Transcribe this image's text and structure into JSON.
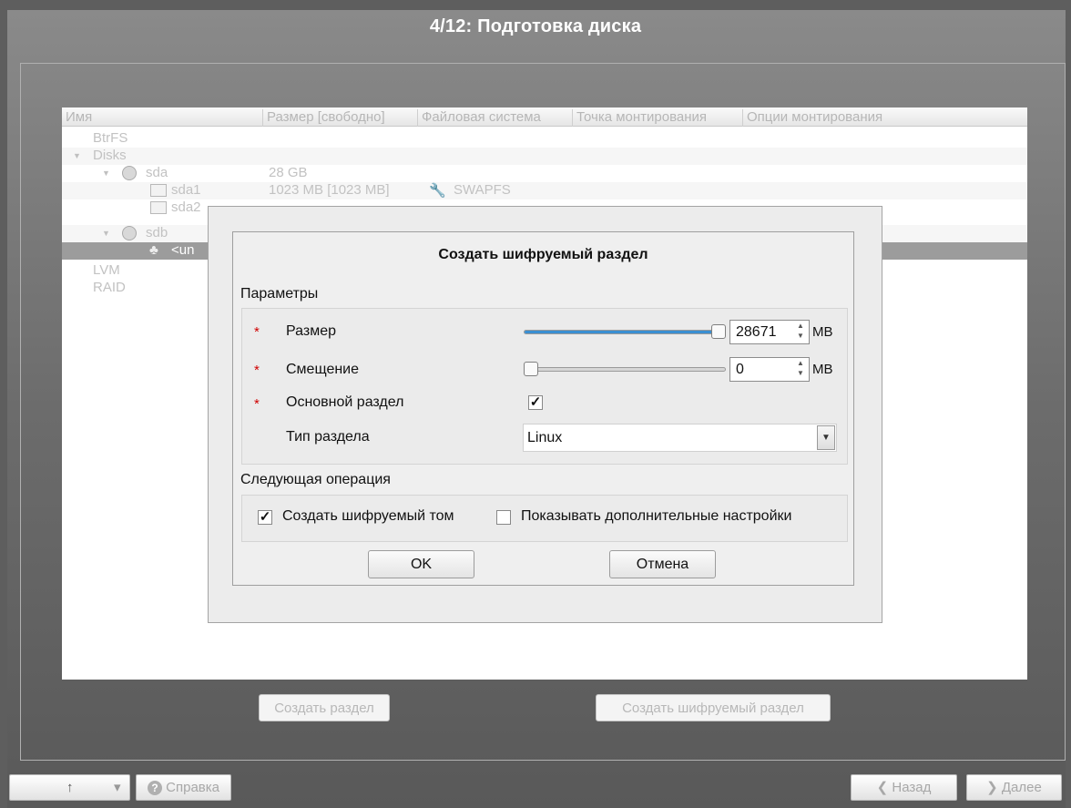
{
  "window": {
    "title": "4/12: Подготовка диска"
  },
  "tree": {
    "columns": [
      "Имя",
      "Размер [свободно]",
      "Файловая система",
      "Точка монтирования",
      "Опции монтирования"
    ],
    "rows": [
      {
        "name": "BtrFS"
      },
      {
        "name": "Disks",
        "expander": "▼"
      },
      {
        "name": "sda",
        "expander": "▼",
        "size": "28 GB"
      },
      {
        "name": "sda1",
        "size": "1023 MB [1023 MB]",
        "fs": "SWAPFS"
      },
      {
        "name": "sda2"
      },
      {
        "name": "sdb",
        "expander": "▼"
      },
      {
        "name": "<un"
      },
      {
        "name": "LVM"
      },
      {
        "name": "RAID"
      }
    ]
  },
  "buttons": {
    "create_partition": "Создать раздел",
    "create_encrypted_partition": "Создать шифруемый раздел"
  },
  "dialog": {
    "title": "Создать шифруемый раздел",
    "params_label": "Параметры",
    "required_mark": "*",
    "size": {
      "label": "Размер",
      "value": "28671",
      "unit": "MB",
      "slider_fraction": 1.0
    },
    "offset": {
      "label": "Смещение",
      "value": "0",
      "unit": "MB",
      "slider_fraction": 0.0
    },
    "primary": {
      "label": "Основной раздел",
      "checked": true,
      "check_glyph": "✓"
    },
    "type": {
      "label": "Тип раздела",
      "value": "Linux"
    },
    "next_label": "Следующая операция",
    "create_volume": {
      "label": "Создать шифруемый том",
      "checked": true
    },
    "show_advanced": {
      "label": "Показывать дополнительные настройки",
      "checked": false
    },
    "ok": "OK",
    "cancel": "Отмена"
  },
  "nav": {
    "up_glyph": "↑",
    "menu_glyph": "▾",
    "help": "Справка",
    "help_glyph": "?",
    "back": "Назад",
    "back_glyph": "❮",
    "next": "Далее",
    "next_glyph": "❯"
  },
  "colors": {
    "accent": "#3a8fd1",
    "required": "#d00000",
    "selection": "#9c9c9c"
  }
}
